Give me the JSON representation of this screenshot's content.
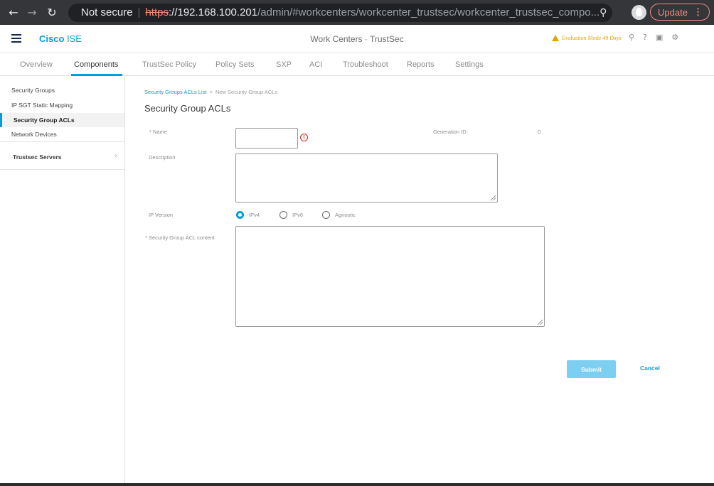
{
  "browser": {
    "not_secure": "Not secure",
    "url_scheme": "https",
    "url_host": "://192.168.100.201",
    "url_path": "/admin/#workcenters/workcenter_trustsec/workcenter_trustsec_compo...",
    "update_label": "Update",
    "update_menu": "⋮"
  },
  "header": {
    "brand_bold": "Cisco",
    "brand_light": " ISE",
    "center_title": "Work Centers · TrustSec",
    "eval_badge": "Evaluation Mode 49 Days"
  },
  "tabs": [
    {
      "label": "Overview"
    },
    {
      "label": "Components"
    },
    {
      "label": "TrustSec Policy"
    },
    {
      "label": "Policy Sets"
    },
    {
      "label": "SXP"
    },
    {
      "label": "ACI"
    },
    {
      "label": "Troubleshoot"
    },
    {
      "label": "Reports"
    },
    {
      "label": "Settings"
    }
  ],
  "sidebar": {
    "items": [
      {
        "label": "Security Groups"
      },
      {
        "label": "IP SGT Static Mapping"
      },
      {
        "label": "Security Group ACLs"
      },
      {
        "label": "Network Devices"
      }
    ],
    "servers_label": "Trustsec Servers",
    "servers_chevron": "›"
  },
  "main": {
    "breadcrumb_link": "Security Groups ACLs List",
    "breadcrumb_sep": ">",
    "breadcrumb_current": "New Security Group ACLs",
    "title": "Security Group ACLs",
    "name_label": "* Name",
    "name_error": "!",
    "generation_label": "Generation ID:",
    "generation_value": "0",
    "description_label": "Description",
    "ip_version_label": "IP Version",
    "ip_options": [
      {
        "label": "IPv4",
        "checked": true
      },
      {
        "label": "IPv6",
        "checked": false
      },
      {
        "label": "Agnostic",
        "checked": false
      }
    ],
    "acl_content_label": "* Security Group ACL content",
    "submit_label": "Submit",
    "cancel_label": "Cancel"
  },
  "colors": {
    "accent": "#049fd9",
    "warning": "#e8a200",
    "error": "#e2231a"
  }
}
